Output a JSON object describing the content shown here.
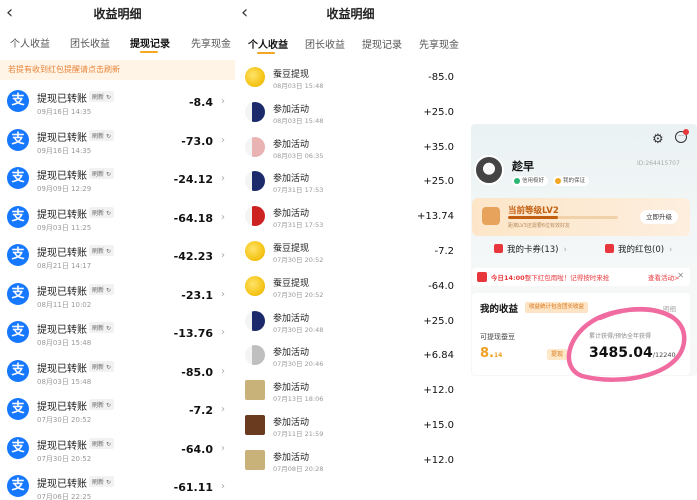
{
  "colors": {
    "accent": "#f5a623",
    "alipay": "#1677ff",
    "red": "#e8373c",
    "highlight": "#f06ba0"
  },
  "p1": {
    "title": "收益明细",
    "tabs": [
      "个人收益",
      "团长收益",
      "提现记录",
      "先享现金"
    ],
    "notice": "若提有收到红包提醒请点击刷新",
    "rows": [
      {
        "name": "提现已转账",
        "tag": "刷新",
        "time": "09月16日 14:35",
        "amount": "-8.4"
      },
      {
        "name": "提现已转账",
        "tag": "刷新",
        "time": "09月16日 14:35",
        "amount": "-73.0"
      },
      {
        "name": "提现已转账",
        "tag": "刷新",
        "time": "09月09日 12:29",
        "amount": "-24.12"
      },
      {
        "name": "提现已转账",
        "tag": "刷新",
        "time": "09月03日 11:25",
        "amount": "-64.18"
      },
      {
        "name": "提现已转账",
        "tag": "刷新",
        "time": "08月21日 14:17",
        "amount": "-42.23"
      },
      {
        "name": "提现已转账",
        "tag": "刷新",
        "time": "08月11日 10:02",
        "amount": "-23.1"
      },
      {
        "name": "提现已转账",
        "tag": "刷新",
        "time": "08月03日 15:48",
        "amount": "-13.76"
      },
      {
        "name": "提现已转账",
        "tag": "刷新",
        "time": "08月03日 15:48",
        "amount": "-85.0"
      },
      {
        "name": "提现已转账",
        "tag": "刷新",
        "time": "07月30日 20:52",
        "amount": "-7.2"
      },
      {
        "name": "提现已转账",
        "tag": "刷新",
        "time": "07月30日 20:52",
        "amount": "-64.0"
      },
      {
        "name": "提现已转账",
        "tag": "刷新",
        "time": "07月06日 22:25",
        "amount": "-61.11"
      }
    ]
  },
  "p2": {
    "title": "收益明细",
    "tabs": [
      "个人收益",
      "团长收益",
      "提现记录",
      "先享现金"
    ],
    "rows": [
      {
        "name": "蚕豆提现",
        "time": "08月03日 15:48",
        "amount": "-85.0",
        "thumb": "bean"
      },
      {
        "name": "参加活动",
        "time": "08月03日 15:48",
        "amount": "+25.0",
        "thumb": "act"
      },
      {
        "name": "参加活动",
        "time": "08月03日 06:35",
        "amount": "+35.0",
        "thumb": "act2"
      },
      {
        "name": "参加活动",
        "time": "07月31日 17:53",
        "amount": "+25.0",
        "thumb": "act"
      },
      {
        "name": "参加活动",
        "time": "07月31日 17:53",
        "amount": "+13.74",
        "thumb": "act3"
      },
      {
        "name": "蚕豆提现",
        "time": "07月30日 20:52",
        "amount": "-7.2",
        "thumb": "bean"
      },
      {
        "name": "蚕豆提现",
        "time": "07月30日 20:52",
        "amount": "-64.0",
        "thumb": "bean"
      },
      {
        "name": "参加活动",
        "time": "07月30日 20:48",
        "amount": "+25.0",
        "thumb": "act"
      },
      {
        "name": "参加活动",
        "time": "07月30日 20:46",
        "amount": "+6.84",
        "thumb": "act4"
      },
      {
        "name": "参加活动",
        "time": "07月13日 18:06",
        "amount": "+12.0",
        "thumb": "khaki"
      },
      {
        "name": "参加活动",
        "time": "07月11日 21:59",
        "amount": "+15.0",
        "thumb": "brown"
      },
      {
        "name": "参加活动",
        "time": "07月08日 20:28",
        "amount": "+12.0",
        "thumb": "khaki"
      }
    ]
  },
  "p3": {
    "username": "趁早",
    "user_id": "ID:264415707",
    "badges": [
      "信用极好",
      "我的保证"
    ],
    "level": {
      "title": "当前等级LV2",
      "progress": 0.45,
      "sub": "距离LV3还需要6位有效好友",
      "button": "立即升级"
    },
    "vouchers": {
      "cards": "我的卡券(13)",
      "redpacket": "我的红包(0)"
    },
    "banner": {
      "prefix": "今日14:00",
      "text": "整下红包雨啦！记得按时来抢",
      "link": "查看活动>"
    },
    "earnings": {
      "title": "我的收益",
      "tag": "收益统计包含团长收益",
      "detail": "明细",
      "withdrawable_label": "可提现蚕豆",
      "withdrawable_main": "8.",
      "withdrawable_dec": "14",
      "withdraw_btn": "提现",
      "total_label": "累计获得/预估全年获得",
      "total_value": "3485.04",
      "total_est": "/12240"
    }
  }
}
